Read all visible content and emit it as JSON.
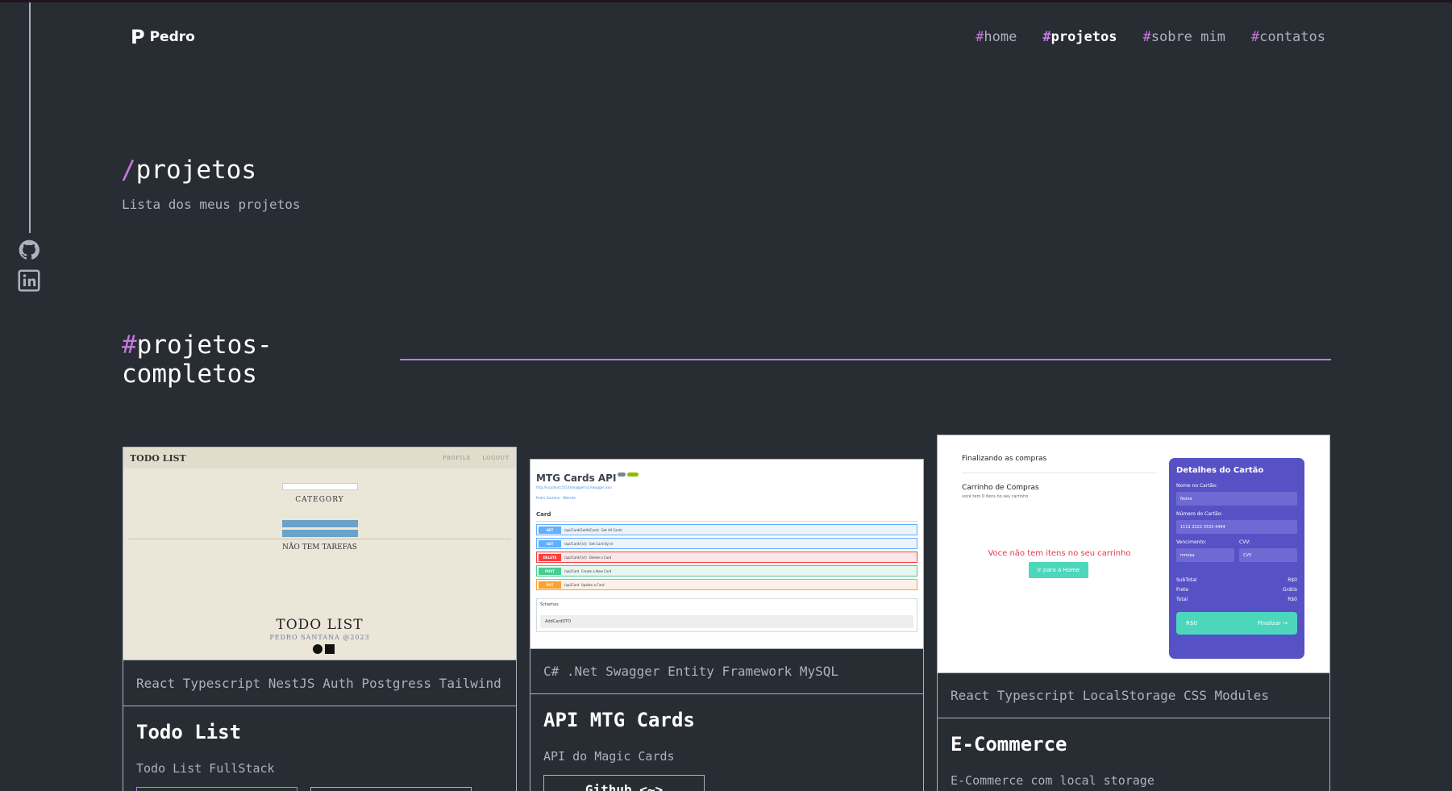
{
  "header": {
    "logo_glyph": "P",
    "logo_text": "Pedro",
    "nav": [
      {
        "hash": "#",
        "label": "home"
      },
      {
        "hash": "#",
        "label": "projetos"
      },
      {
        "hash": "#",
        "label": "sobre mim"
      },
      {
        "hash": "#",
        "label": "contatos"
      }
    ],
    "active_nav": "projetos"
  },
  "sidebar": {
    "icons": [
      "github-icon",
      "linkedin-icon"
    ]
  },
  "page": {
    "title_slash": "/",
    "title": "projetos",
    "subtitle": "Lista dos meus projetos"
  },
  "section": {
    "hash": "#",
    "title": "projetos-completos"
  },
  "colors": {
    "background": "#282c33",
    "accent": "#c778dd",
    "text_muted": "#abb2bf"
  },
  "projects": [
    {
      "tech": "React Typescript NestJS Auth Postgress Tailwind",
      "name": "Todo List",
      "description": "Todo List FullStack",
      "preview": {
        "brand": "TODO LIST",
        "links": [
          "PROFILE",
          "LOGOUT"
        ],
        "category": "CATEGORY",
        "empty": "NÃO TEM TAREFAS",
        "footer_title": "TODO LIST",
        "footer_author": "PEDRO SANTANA @2023"
      }
    },
    {
      "tech": "C# .Net Swagger Entity Framework MySQL",
      "name": "API MTG Cards",
      "description": "API do Magic Cards",
      "button": "Github <~>",
      "preview": {
        "title": "MTG Cards API",
        "group": "Card",
        "ops": [
          {
            "method": "GET",
            "path": "/api/Card/GetAllCards",
            "summary": "Get All Cards"
          },
          {
            "method": "GET",
            "path": "/api/Card/{id}",
            "summary": "Get Card By Id"
          },
          {
            "method": "DELETE",
            "path": "/api/Card/{id}",
            "summary": "Delete a Card"
          },
          {
            "method": "POST",
            "path": "/api/Card",
            "summary": "Create a New Card"
          },
          {
            "method": "PUT",
            "path": "/api/Card",
            "summary": "Update a Card"
          }
        ],
        "schemas": "Schemas",
        "schema_item": "AddCardDTO"
      }
    },
    {
      "tech": "React Typescript LocalStorage CSS Modules",
      "name": "E-Commerce",
      "description": "E-Commerce com local storage",
      "preview": {
        "heading": "Finalizando as compras",
        "cart": "Carrinho de Compras",
        "cart_sub": "você tem 0 itens no seu carrinho",
        "empty": "Voce não tem itens no seu carrinho",
        "home_btn": "Ir para a Home",
        "panel_title": "Detalhes do Cartão",
        "name_label": "Nome no Cartão:",
        "name_ph": "Nome",
        "number_label": "Número do Cartão:",
        "number_ph": "1111 2222 3333 4444",
        "exp_label": "Vencimento:",
        "exp_ph": "mm/aa",
        "cvv_label": "CVV:",
        "cvv_ph": "CVV",
        "subtotal": "SubTotal",
        "subtotal_v": "R$0",
        "frete": "Frete",
        "frete_v": "Grátis",
        "total": "Total",
        "total_v": "R$0",
        "pay_left": "R$0",
        "pay_right": "Finalizar →"
      }
    }
  ]
}
